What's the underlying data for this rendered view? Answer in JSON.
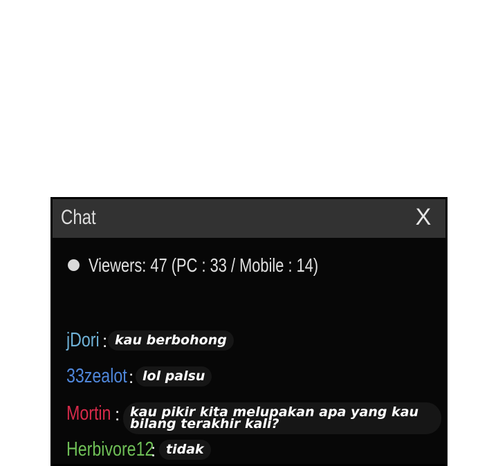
{
  "window": {
    "title": "Chat",
    "close_label": "X"
  },
  "viewers": {
    "text": "Viewers: 47 (PC : 33 / Mobile : 14)"
  },
  "messages": [
    {
      "user": "jDori",
      "separator": ":",
      "text": "kau berbohong",
      "color": "#6fb1d6"
    },
    {
      "user": "33zealot",
      "separator": ":",
      "text": "lol palsu",
      "color": "#4f86d9"
    },
    {
      "user": "Mortin",
      "separator": ":",
      "text": "kau pikir kita melupakan apa yang kau bilang terakhir kali?",
      "color": "#d72a4a"
    },
    {
      "user": "Herbivore12",
      "separator": ":",
      "text": "tidak",
      "color": "#6fbf57"
    }
  ]
}
